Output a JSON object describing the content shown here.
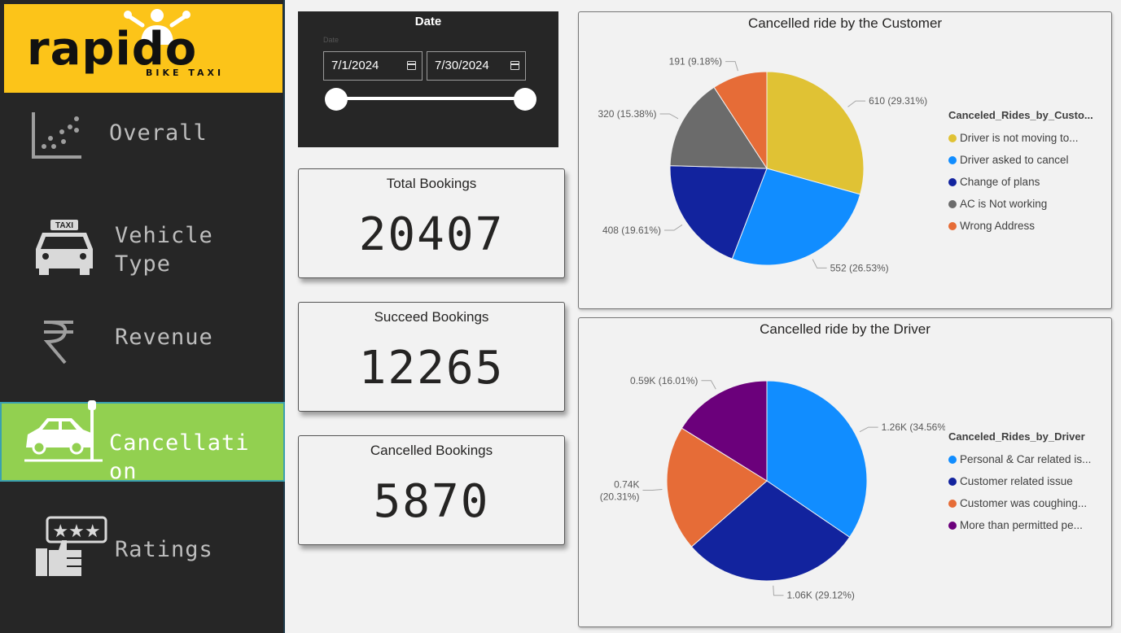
{
  "logo": {
    "brand": "rapido",
    "tagline": "BIKE TAXI"
  },
  "nav": [
    {
      "label": "Overall",
      "icon": "scatter-chart-icon"
    },
    {
      "label": "Vehicle Type",
      "icon": "taxi-icon"
    },
    {
      "label": "Revenue",
      "icon": "rupee-icon"
    },
    {
      "label": "Cancellati on",
      "icon": "car-crash-icon",
      "active": true
    },
    {
      "label": "Ratings",
      "icon": "star-rating-thumbs-up-icon"
    }
  ],
  "date_slicer": {
    "title": "Date",
    "field_label": "Date",
    "start": "7/1/2024",
    "end": "7/30/2024"
  },
  "kpis": {
    "total": {
      "label": "Total Bookings",
      "value": "20407"
    },
    "succeed": {
      "label": "Succeed Bookings",
      "value": "12265"
    },
    "cancelled": {
      "label": "Cancelled Bookings",
      "value": "5870"
    }
  },
  "chart_data": [
    {
      "type": "pie",
      "title": "Cancelled ride by the Customer",
      "legend_title": "Canceled_Rides_by_Custo...",
      "legend_position": "right",
      "slices": [
        {
          "label": "Driver is not moving to...",
          "value": 610,
          "data_label": "610 (29.31%)",
          "color": "#e0c234"
        },
        {
          "label": "Driver asked to cancel",
          "value": 552,
          "data_label": "552 (26.53%)",
          "color": "#118dff"
        },
        {
          "label": "Change of plans",
          "value": 408,
          "data_label": "408 (19.61%)",
          "color": "#12239e"
        },
        {
          "label": "AC is Not working",
          "value": 320,
          "data_label": "320 (15.38%)",
          "color": "#6b6b6b"
        },
        {
          "label": "Wrong Address",
          "value": 191,
          "data_label": "191 (9.18%)",
          "color": "#e66c37"
        }
      ]
    },
    {
      "type": "pie",
      "title": "Cancelled ride by the Driver",
      "legend_title": "Canceled_Rides_by_Driver",
      "legend_position": "right",
      "slices": [
        {
          "label": "Personal & Car related is...",
          "value": 1260,
          "data_label": "1.26K (34.56%)",
          "color": "#118dff"
        },
        {
          "label": "Customer related issue",
          "value": 1060,
          "data_label": "1.06K (29.12%)",
          "color": "#12239e"
        },
        {
          "label": "Customer was coughing...",
          "value": 740,
          "data_label": "0.74K\n(20.31%)",
          "color": "#e66c37"
        },
        {
          "label": "More than permitted pe...",
          "value": 590,
          "data_label": "0.59K (16.01%)",
          "color": "#6b007b"
        }
      ]
    }
  ]
}
